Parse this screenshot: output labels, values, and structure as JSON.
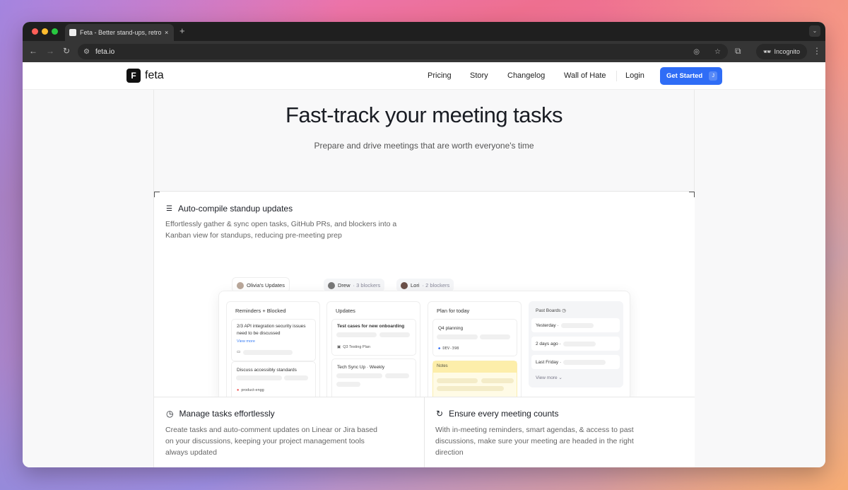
{
  "browser": {
    "tab_title": "Feta - Better stand-ups, retro",
    "url": "feta.io",
    "incognito_label": "Incognito",
    "new_tab": "+",
    "close": "×"
  },
  "nav": {
    "logo_text": "feta",
    "links": [
      "Pricing",
      "Story",
      "Changelog",
      "Wall of Hate",
      "Login"
    ],
    "cta_label": "Get Started",
    "cta_shortcut": "J",
    "accent": "#2f6df6"
  },
  "hero": {
    "title": "Fast-track your meeting tasks",
    "subtitle": "Prepare and drive meetings that are worth everyone's time"
  },
  "features": [
    {
      "title": "Auto-compile standup updates",
      "description": "Effortlessly gather & sync open tasks, GitHub PRs, and blockers into a Kanban view for standups, reducing pre-meeting prep",
      "icon": "checklist-icon"
    },
    {
      "title": "Manage tasks effortlessly",
      "description": "Create tasks and auto-comment updates on Linear or Jira based on your discussions, keeping your project management tools always updated",
      "icon": "clock-icon"
    },
    {
      "title": "Ensure every meeting counts",
      "description": "With in-meeting reminders, smart agendas, & access to past discussions, make sure your meeting are headed in the right direction",
      "icon": "refresh-icon"
    }
  ],
  "board": {
    "tabs": [
      {
        "name": "Olivia's Updates",
        "extra": ""
      },
      {
        "name": "Drew",
        "extra": "· 3 blockers"
      },
      {
        "name": "Lori",
        "extra": "· 2 blockers"
      }
    ],
    "columns": {
      "reminders": {
        "title": "Reminders + Blocked",
        "card1": "2/3 API integration security issues need to be discussed",
        "view_more": "View more",
        "card2": "Discuss accessibly standards",
        "card2_tag": "product-engg"
      },
      "updates": {
        "title": "Updates",
        "card1": "Test cases for new onboarding",
        "card1_tag": "Q3 Testing Plan",
        "card2": "Tech Sync Up · Weekly"
      },
      "plan": {
        "title": "Plan for today",
        "card1": "Q4 planning",
        "card1_tag": "DEV-398",
        "notes": "Notes"
      },
      "past": {
        "title": "Past Boards",
        "items": [
          "Yesterday ·",
          "2 days ago ·",
          "Last Friday ·"
        ],
        "view_more": "View more"
      }
    }
  }
}
